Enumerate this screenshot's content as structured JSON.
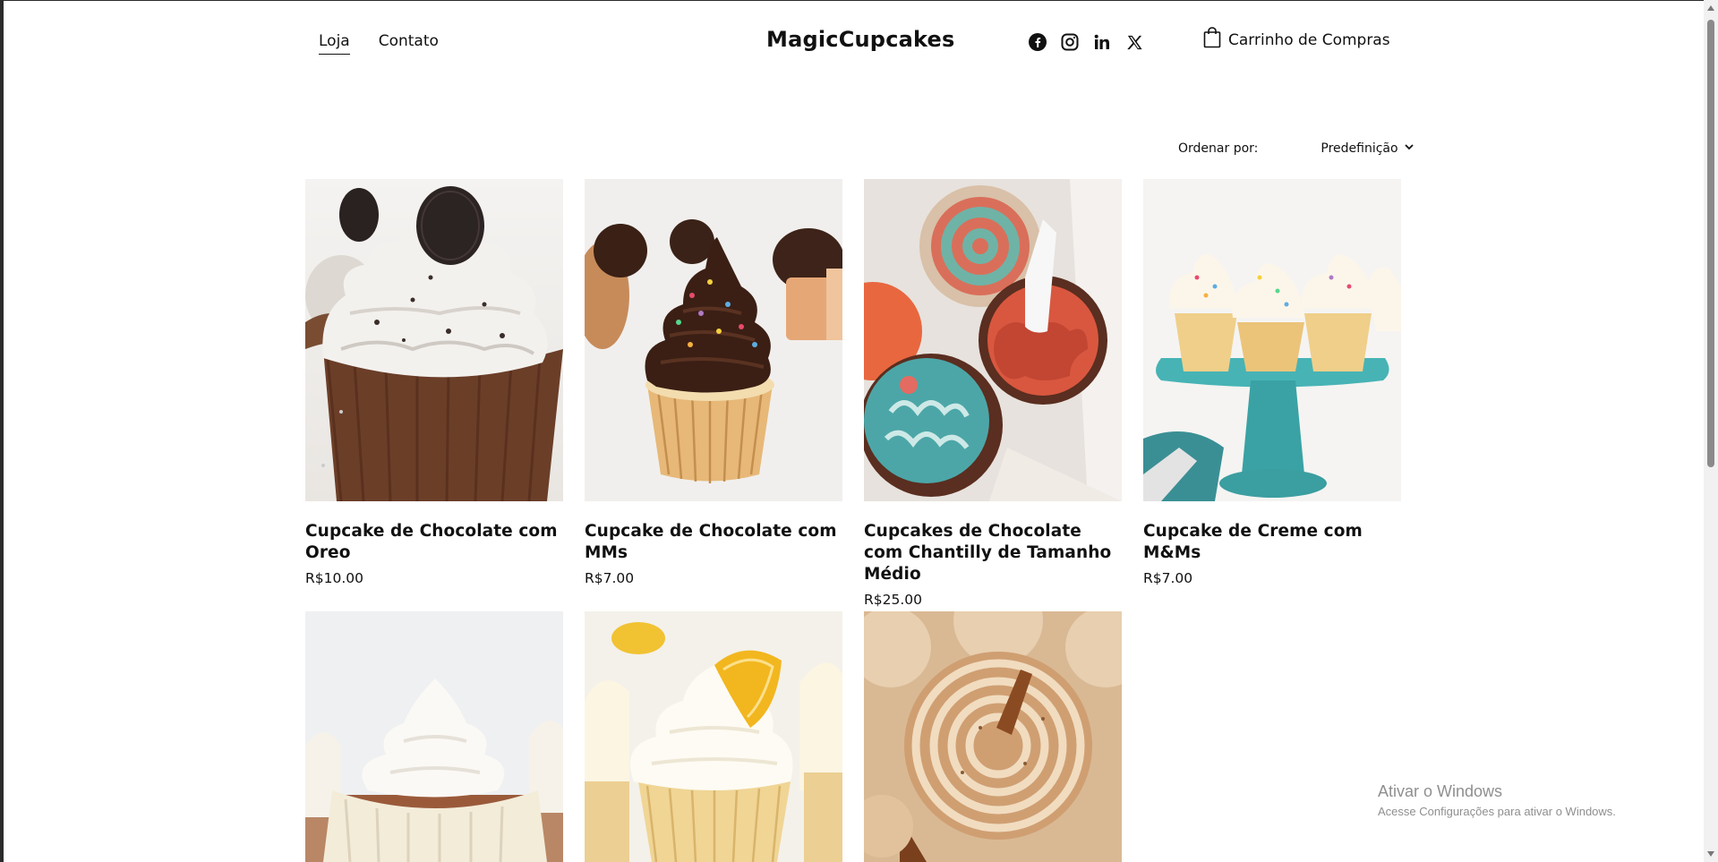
{
  "header": {
    "nav": [
      {
        "label": "Loja",
        "active": true
      },
      {
        "label": "Contato",
        "active": false
      }
    ],
    "brand": "MagicCupcakes",
    "socials": [
      "facebook-icon",
      "instagram-icon",
      "linkedin-icon",
      "x-icon"
    ],
    "cart_label": "Carrinho de Compras"
  },
  "sort": {
    "label": "Ordenar por:",
    "selected": "Predefinição"
  },
  "products": [
    {
      "name": "Cupcake de Chocolate com Oreo",
      "price": "R$10.00"
    },
    {
      "name": "Cupcake de Chocolate com MMs",
      "price": "R$7.00"
    },
    {
      "name": "Cupcakes de Chocolate com Chantilly de Tamanho Médio",
      "price": "R$25.00"
    },
    {
      "name": "Cupcake de Creme com M&Ms",
      "price": "R$7.00"
    },
    {
      "name": "",
      "price": ""
    },
    {
      "name": "",
      "price": ""
    },
    {
      "name": "",
      "price": ""
    }
  ],
  "watermark": {
    "title": "Ativar o Windows",
    "subtitle": "Acesse Configurações para ativar o Windows."
  },
  "colors": {
    "text": "#111111",
    "background": "#ffffff",
    "watermark": "#8f8f8f"
  }
}
